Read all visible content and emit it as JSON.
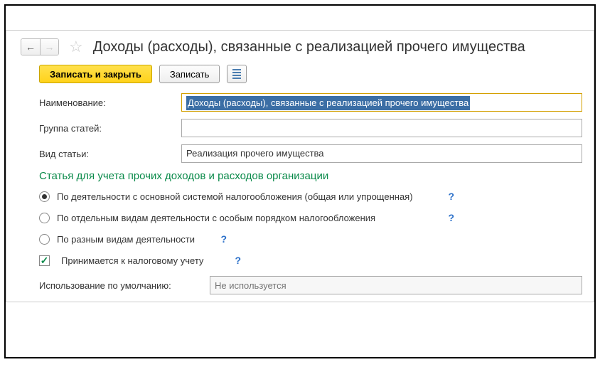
{
  "header": {
    "title": "Доходы (расходы), связанные с реализацией прочего имущества"
  },
  "toolbar": {
    "save_close_label": "Записать и закрыть",
    "save_label": "Записать"
  },
  "form": {
    "name_label": "Наименование:",
    "name_value": "Доходы (расходы), связанные с реализацией прочего имущества",
    "group_label": "Группа статей:",
    "group_value": "",
    "type_label": "Вид статьи:",
    "type_value": "Реализация прочего имущества"
  },
  "section": {
    "title": "Статья для учета прочих доходов и расходов организации",
    "radio1": "По деятельности с основной системой налогообложения (общая или упрощенная)",
    "radio2": "По отдельным видам деятельности с особым порядком налогообложения",
    "radio3": "По разным видам деятельности",
    "checkbox1": "Принимается к налоговому учету",
    "help": "?"
  },
  "usage": {
    "label": "Использование по умолчанию:",
    "placeholder": "Не используется"
  }
}
